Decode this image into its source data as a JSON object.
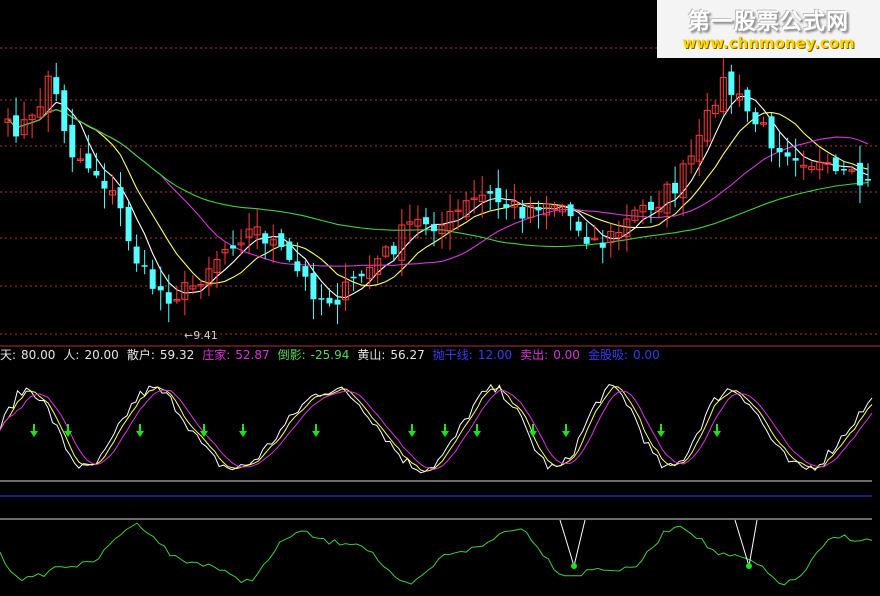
{
  "watermark": {
    "title": "第一股票公式网",
    "url": "www.chnmoney.com"
  },
  "price_panel": {
    "low_label": "9.41",
    "arrow_glyph": "←"
  },
  "indicator_legend": [
    {
      "label": "天:",
      "value": "80.00",
      "color": "#e6e6e6"
    },
    {
      "label": "人:",
      "value": "20.00",
      "color": "#e6e6e6"
    },
    {
      "label": "散户:",
      "value": "59.32",
      "color": "#e6e6e6"
    },
    {
      "label": "庄家:",
      "value": "52.87",
      "color": "#d638d6"
    },
    {
      "label": "倒影:",
      "value": "-25.94",
      "color": "#58d658"
    },
    {
      "label": "黄山:",
      "value": "56.27",
      "color": "#e6e6e6"
    },
    {
      "label": "抛干线:",
      "value": "12.00",
      "color": "#3a3af0"
    },
    {
      "label": "卖出:",
      "value": "0.00",
      "color": "#d638d6"
    },
    {
      "label": "金股吸:",
      "value": "0.00",
      "color": "#3a3af0"
    }
  ],
  "colors": {
    "background": "#000000",
    "candle_up": "#ff3b3b",
    "candle_down": "#54ffff",
    "ma_short": "#ffffff",
    "ma_mid": "#ffff66",
    "ma_long": "#d638d6",
    "ma_xlong": "#3fcf3f",
    "grid": "#a33a3a",
    "signal_arrow": "#19e619"
  },
  "icons": {
    "sell_arrow": "down-arrow-icon",
    "low_marker": "left-arrow-icon"
  }
}
